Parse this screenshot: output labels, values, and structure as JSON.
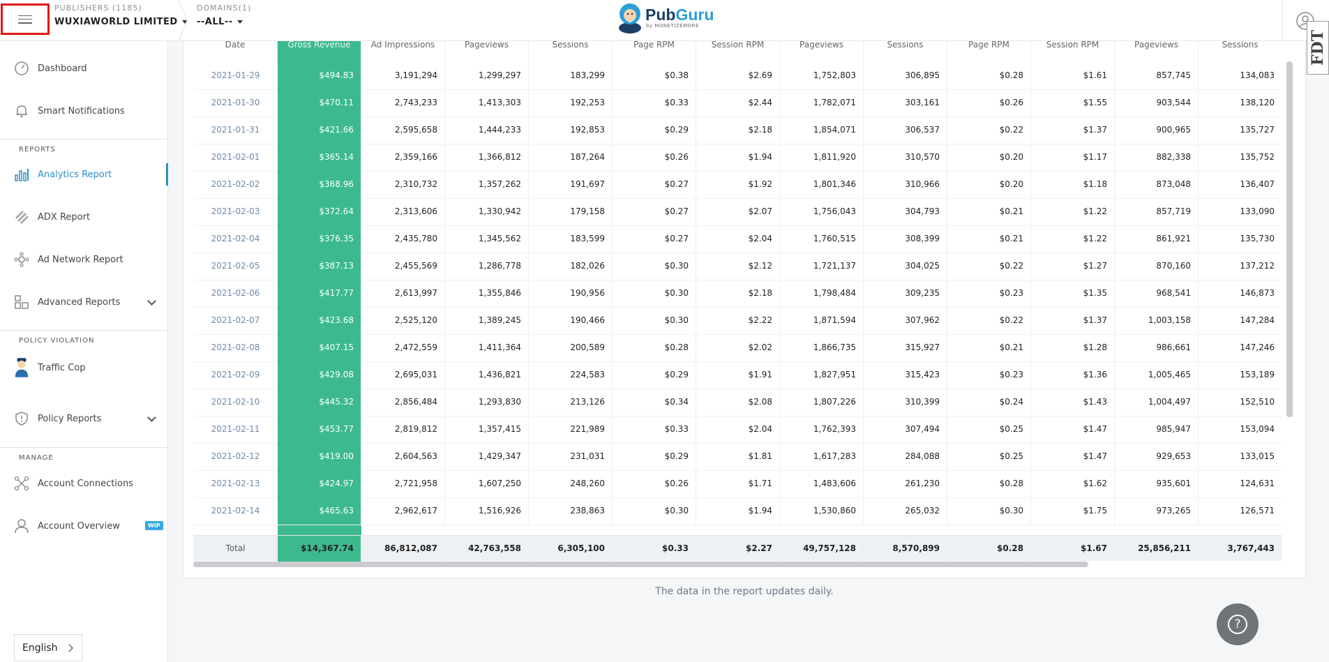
{
  "header": {
    "publishers_label": "PUBLISHERS (1185)",
    "publisher_value": "WUXIAWORLD LIMITED",
    "domains_label": "DOMAINS(1)",
    "domain_value": "--ALL--",
    "logo_name_a": "Pub",
    "logo_name_b": "Guru",
    "logo_sub": "by MONETIZEMORE"
  },
  "sidebar": {
    "dashboard": "Dashboard",
    "smart_notifications": "Smart Notifications",
    "reports_section": "REPORTS",
    "analytics_report": "Analytics Report",
    "adx_report": "ADX Report",
    "ad_network_report": "Ad Network Report",
    "advanced_reports": "Advanced Reports",
    "policy_section": "POLICY VIOLATION",
    "traffic_cop": "Traffic Cop",
    "policy_reports": "Policy Reports",
    "manage_section": "MANAGE",
    "account_connections": "Account Connections",
    "account_overview": "Account Overview",
    "wip_badge": "WIP",
    "language": "English"
  },
  "table": {
    "headers": [
      "Date",
      "Gross Revenue",
      "Ad Impressions",
      "Pageviews",
      "Sessions",
      "Page RPM",
      "Session RPM",
      "Pageviews",
      "Sessions",
      "Page RPM",
      "Session RPM",
      "Pageviews",
      "Sessions"
    ],
    "rows": [
      [
        "2021-01-29",
        "$494.83",
        "3,191,294",
        "1,299,297",
        "183,299",
        "$0.38",
        "$2.69",
        "1,752,803",
        "306,895",
        "$0.28",
        "$1.61",
        "857,745",
        "134,083"
      ],
      [
        "2021-01-30",
        "$470.11",
        "2,743,233",
        "1,413,303",
        "192,253",
        "$0.33",
        "$2.44",
        "1,782,071",
        "303,161",
        "$0.26",
        "$1.55",
        "903,544",
        "138,120"
      ],
      [
        "2021-01-31",
        "$421.66",
        "2,595,658",
        "1,444,233",
        "192,853",
        "$0.29",
        "$2.18",
        "1,854,071",
        "306,537",
        "$0.22",
        "$1.37",
        "900,965",
        "135,727"
      ],
      [
        "2021-02-01",
        "$365.14",
        "2,359,166",
        "1,366,812",
        "187,264",
        "$0.26",
        "$1.94",
        "1,811,920",
        "310,570",
        "$0.20",
        "$1.17",
        "882,338",
        "135,752"
      ],
      [
        "2021-02-02",
        "$368.96",
        "2,310,732",
        "1,357,262",
        "191,697",
        "$0.27",
        "$1.92",
        "1,801,346",
        "310,966",
        "$0.20",
        "$1.18",
        "873,048",
        "136,407"
      ],
      [
        "2021-02-03",
        "$372.64",
        "2,313,606",
        "1,330,942",
        "179,158",
        "$0.27",
        "$2.07",
        "1,756,043",
        "304,793",
        "$0.21",
        "$1.22",
        "857,719",
        "133,090"
      ],
      [
        "2021-02-04",
        "$376.35",
        "2,435,780",
        "1,345,562",
        "183,599",
        "$0.27",
        "$2.04",
        "1,760,515",
        "308,399",
        "$0.21",
        "$1.22",
        "861,921",
        "135,730"
      ],
      [
        "2021-02-05",
        "$387.13",
        "2,455,569",
        "1,286,778",
        "182,026",
        "$0.30",
        "$2.12",
        "1,721,137",
        "304,025",
        "$0.22",
        "$1.27",
        "870,160",
        "137,212"
      ],
      [
        "2021-02-06",
        "$417.77",
        "2,613,997",
        "1,355,846",
        "190,956",
        "$0.30",
        "$2.18",
        "1,798,484",
        "309,235",
        "$0.23",
        "$1.35",
        "968,541",
        "146,873"
      ],
      [
        "2021-02-07",
        "$423.68",
        "2,525,120",
        "1,389,245",
        "190,466",
        "$0.30",
        "$2.22",
        "1,871,594",
        "307,962",
        "$0.22",
        "$1.37",
        "1,003,158",
        "147,284"
      ],
      [
        "2021-02-08",
        "$407.15",
        "2,472,559",
        "1,411,364",
        "200,589",
        "$0.28",
        "$2.02",
        "1,866,735",
        "315,927",
        "$0.21",
        "$1.28",
        "986,661",
        "147,246"
      ],
      [
        "2021-02-09",
        "$429.08",
        "2,695,031",
        "1,436,821",
        "224,583",
        "$0.29",
        "$1.91",
        "1,827,951",
        "315,423",
        "$0.23",
        "$1.36",
        "1,005,465",
        "153,189"
      ],
      [
        "2021-02-10",
        "$445.32",
        "2,856,484",
        "1,293,830",
        "213,126",
        "$0.34",
        "$2.08",
        "1,807,226",
        "310,399",
        "$0.24",
        "$1.43",
        "1,004,497",
        "152,510"
      ],
      [
        "2021-02-11",
        "$453.77",
        "2,819,812",
        "1,357,415",
        "221,989",
        "$0.33",
        "$2.04",
        "1,762,393",
        "307,494",
        "$0.25",
        "$1.47",
        "985,947",
        "153,094"
      ],
      [
        "2021-02-12",
        "$419.00",
        "2,604,563",
        "1,429,347",
        "231,031",
        "$0.29",
        "$1.81",
        "1,617,283",
        "284,088",
        "$0.25",
        "$1.47",
        "929,653",
        "133,015"
      ],
      [
        "2021-02-13",
        "$424.97",
        "2,721,958",
        "1,607,250",
        "248,260",
        "$0.26",
        "$1.71",
        "1,483,606",
        "261,230",
        "$0.28",
        "$1.62",
        "935,601",
        "124,631"
      ],
      [
        "2021-02-14",
        "$465.63",
        "2,962,617",
        "1,516,926",
        "238,863",
        "$0.30",
        "$1.94",
        "1,530,860",
        "265,032",
        "$0.30",
        "$1.75",
        "973,265",
        "126,571"
      ]
    ],
    "total": [
      "Total",
      "$14,367.74",
      "86,812,087",
      "42,763,558",
      "6,305,100",
      "$0.33",
      "$2.27",
      "49,757,128",
      "8,570,899",
      "$0.28",
      "$1.67",
      "25,856,211",
      "3,767,443"
    ]
  },
  "footer_note": "The data in the report updates daily.",
  "help_label": "?",
  "fdt_badge": "FDT",
  "colors": {
    "accent": "#2a8fc7",
    "gross_revenue": "#3cba8e",
    "highlight_border": "#e2161b"
  }
}
